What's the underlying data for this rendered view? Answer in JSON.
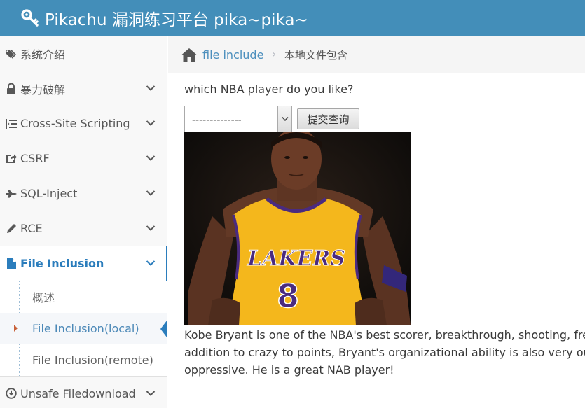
{
  "header": {
    "title": "Pikachu 漏洞练习平台 pika~pika~"
  },
  "sidebar": {
    "items": [
      {
        "label": "系统介绍",
        "icon": "tags-icon",
        "expandable": false
      },
      {
        "label": "暴力破解",
        "icon": "lock-icon",
        "expandable": true
      },
      {
        "label": "Cross-Site Scripting",
        "icon": "indent-icon",
        "expandable": true
      },
      {
        "label": "CSRF",
        "icon": "share-square-icon",
        "expandable": true
      },
      {
        "label": "SQL-Inject",
        "icon": "fighter-jet-icon",
        "expandable": true
      },
      {
        "label": "RCE",
        "icon": "pencil-icon",
        "expandable": true
      },
      {
        "label": "File Inclusion",
        "icon": "file-icon",
        "expandable": true,
        "active": true
      },
      {
        "label": "Unsafe Filedownload",
        "icon": "download-circle-icon",
        "expandable": true
      }
    ],
    "submenu": [
      {
        "label": "概述"
      },
      {
        "label": "File Inclusion(local)",
        "current": true
      },
      {
        "label": "File Inclusion(remote)"
      }
    ]
  },
  "breadcrumbs": {
    "link": "file include",
    "current": "本地文件包含"
  },
  "main": {
    "question": "which NBA player do you like?",
    "select_value": "--------------",
    "submit_label": "提交查询",
    "jersey_text": "LAKERS",
    "jersey_number": "8",
    "description_lines": [
      "Kobe Bryant is one of the NBA's best scorer, breakthrough, shooting, free th",
      "addition to crazy to points, Bryant's organizational ability is also very outstar",
      "oppressive. He is a great NAB player!"
    ]
  },
  "colors": {
    "header_bg": "#438eb9",
    "active_blue": "#2b7dbc",
    "link_blue": "#4c8fbd",
    "jersey_gold": "#f4b71c",
    "jersey_purple": "#4a2b80"
  }
}
